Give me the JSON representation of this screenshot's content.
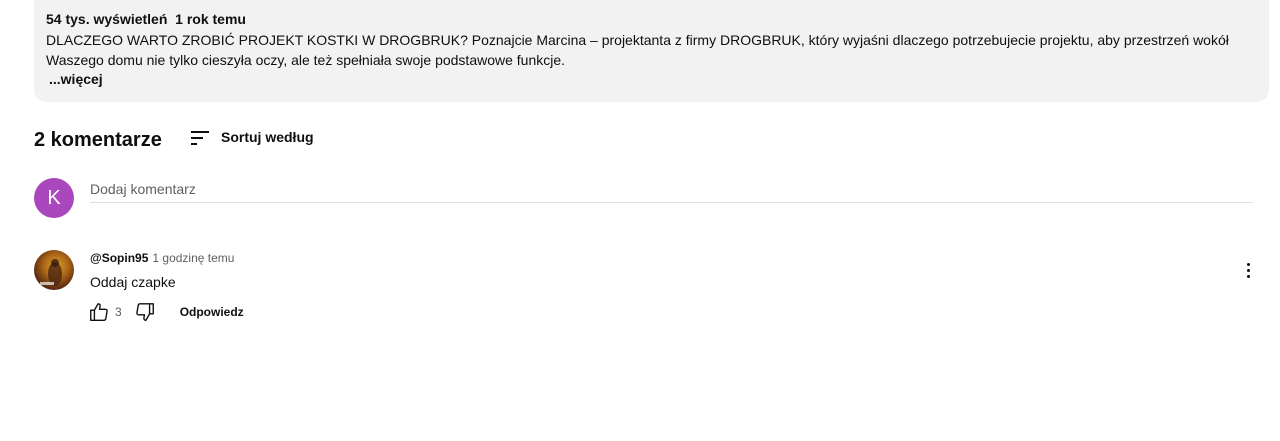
{
  "description": {
    "meta": "54 tys. wyświetleń  1 rok temu",
    "text": "DLACZEGO WARTO ZROBIĆ PROJEKT KOSTKI W DROGBRUK? Poznajcie Marcina – projektanta z firmy DROGBRUK, który wyjaśni dlaczego potrzebujecie projektu, aby przestrzeń wokół Waszego domu nie tylko cieszyła oczy, ale też spełniała swoje podstawowe funkcje.",
    "more_label": "...więcej"
  },
  "comments": {
    "count_label": "2 komentarze",
    "sort_label": "Sortuj według",
    "add": {
      "avatar_letter": "K",
      "placeholder": "Dodaj komentarz",
      "avatar_color": "#ab47bc"
    },
    "items": [
      {
        "author": "@Sopin95",
        "time": "1 godzinę temu",
        "text": "Oddaj czapke",
        "likes": "3",
        "reply_label": "Odpowiedz"
      }
    ]
  }
}
